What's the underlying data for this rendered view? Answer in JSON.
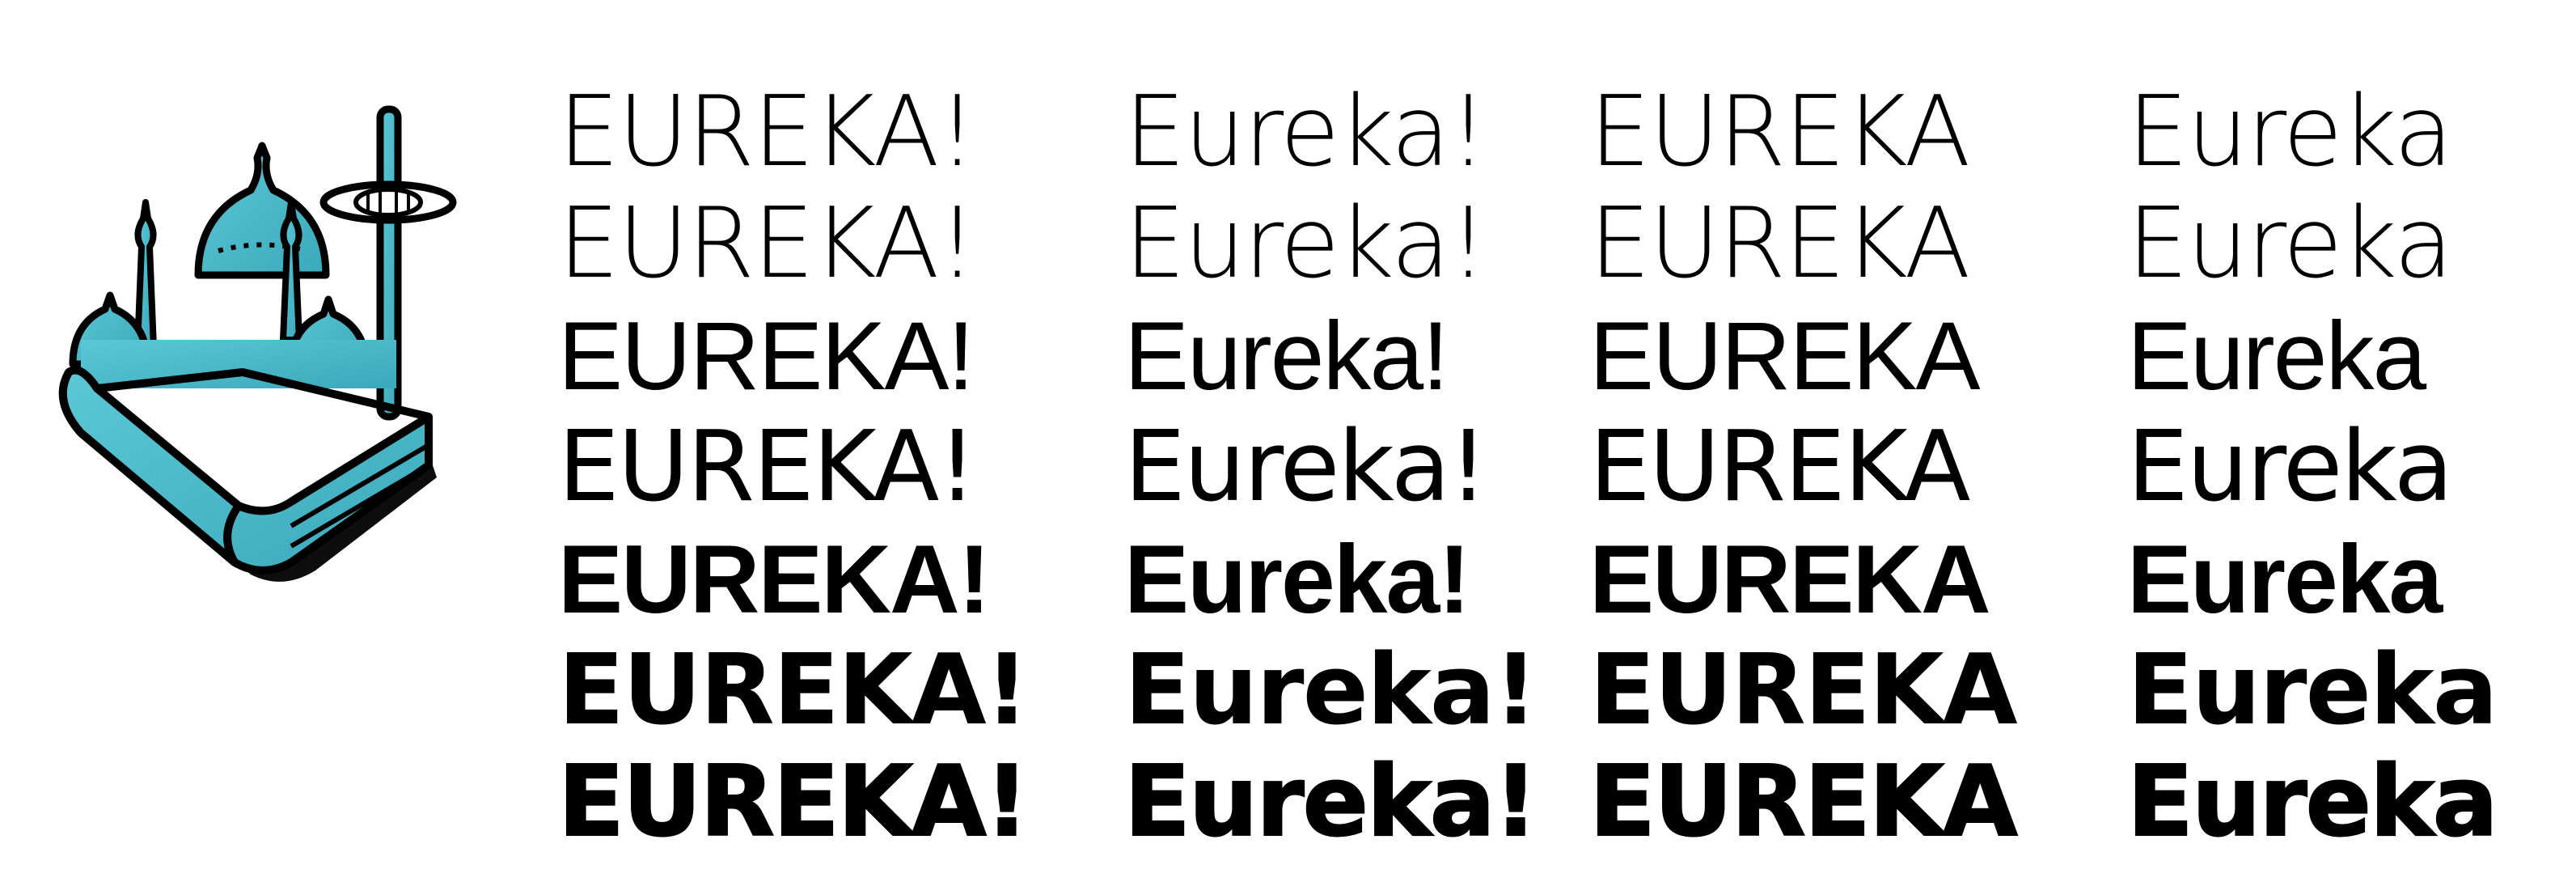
{
  "specimen": {
    "columns": [
      {
        "lines": [
          "EUREKA!",
          "EUREKA!",
          "EUREKA!",
          "EUREKA!",
          "EUREKA!",
          "EUREKA!",
          "EUREKA!"
        ]
      },
      {
        "lines": [
          "Eureka!",
          "Eureka!",
          "Eureka!",
          "Eureka!",
          "Eureka!",
          "Eureka!",
          "Eureka!"
        ]
      },
      {
        "lines": [
          "EUREKA",
          "EUREKA",
          "EUREKA",
          "EUREKA",
          "EUREKA",
          "EUREKA",
          "EUREKA"
        ]
      },
      {
        "lines": [
          "Eureka",
          "Eureka",
          "Eureka",
          "Eureka",
          "Eureka",
          "Eureka",
          "Eureka"
        ]
      }
    ]
  },
  "colors": {
    "logo_fill": "#4fbfcf",
    "logo_stroke": "#000000",
    "text": "#000000",
    "background": "#ffffff"
  }
}
